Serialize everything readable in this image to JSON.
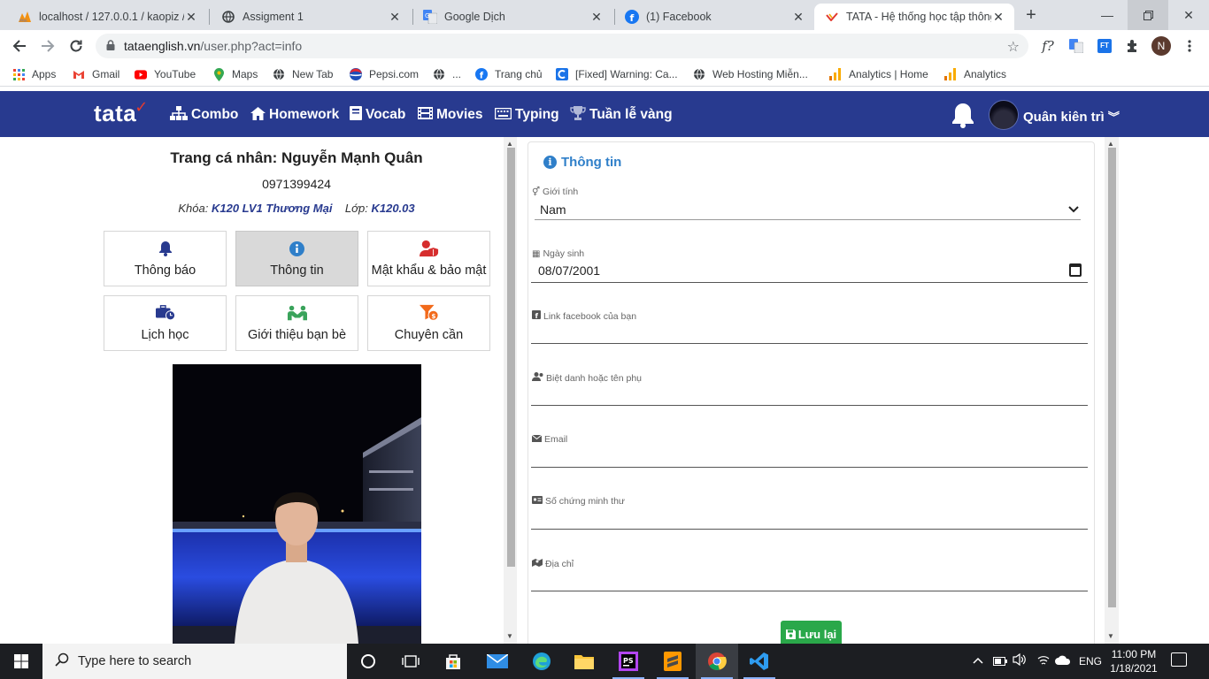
{
  "browser": {
    "tabs": [
      {
        "title": "localhost / 127.0.0.1 / kaopiz /",
        "icon": "phpmyadmin-icon"
      },
      {
        "title": "Assigment 1",
        "icon": "globe-icon"
      },
      {
        "title": "Google Dịch",
        "icon": "google-translate-icon"
      },
      {
        "title": "(1) Facebook",
        "icon": "facebook-icon"
      },
      {
        "title": "TATA - Hệ thống học tập thông",
        "icon": "tata-icon",
        "active": true
      }
    ],
    "url_host": "tataenglish.vn",
    "url_path": "/user.php?act=info",
    "bookmarks": [
      {
        "label": "Apps",
        "icon": "apps-grid-icon"
      },
      {
        "label": "Gmail",
        "icon": "gmail-icon"
      },
      {
        "label": "YouTube",
        "icon": "youtube-icon"
      },
      {
        "label": "Maps",
        "icon": "maps-icon"
      },
      {
        "label": "New Tab",
        "icon": "globe-icon"
      },
      {
        "label": "Pepsi.com",
        "icon": "pepsi-icon"
      },
      {
        "label": "...",
        "icon": "globe-icon"
      },
      {
        "label": "Trang chủ",
        "icon": "facebook-icon"
      },
      {
        "label": "[Fixed] Warning: Ca...",
        "icon": "c-icon"
      },
      {
        "label": "Web Hosting Miễn...",
        "icon": "globe-icon"
      },
      {
        "label": "Analytics | Home",
        "icon": "analytics-icon"
      },
      {
        "label": "Analytics",
        "icon": "analytics-icon"
      }
    ],
    "profile_initial": "N",
    "ext_formula": "f?",
    "ext_ft": "FT"
  },
  "site": {
    "logo": "tata",
    "nav": [
      {
        "label": "Combo",
        "icon": "sitemap-icon"
      },
      {
        "label": "Homework",
        "icon": "home-icon"
      },
      {
        "label": "Vocab",
        "icon": "book-icon"
      },
      {
        "label": "Movies",
        "icon": "film-icon"
      },
      {
        "label": "Typing",
        "icon": "keyboard-icon"
      },
      {
        "label": "Tuần lễ vàng",
        "icon": "trophy-icon"
      }
    ],
    "user_name": "Quân kiên trì"
  },
  "profile": {
    "title": "Trang cá nhân: Nguyễn Mạnh Quân",
    "phone": "0971399424",
    "course_label": "Khóa:",
    "course_value": "K120 LV1 Thương Mại",
    "class_label": "Lớp:",
    "class_value": "K120.03",
    "menu": [
      {
        "label": "Thông báo",
        "icon": "bell-icon",
        "color": "#283a8f"
      },
      {
        "label": "Thông tin",
        "icon": "info-icon",
        "color": "#2f7fc9",
        "active": true
      },
      {
        "label": "Mật khẩu & bảo mật",
        "icon": "user-shield-icon",
        "color": "#d62d2d"
      },
      {
        "label": "Lịch học",
        "icon": "briefcase-clock-icon",
        "color": "#283a8f"
      },
      {
        "label": "Giới thiệu bạn bè",
        "icon": "friends-icon",
        "color": "#3aa35b"
      },
      {
        "label": "Chuyên cần",
        "icon": "funnel-coin-icon",
        "color": "#f26a1b"
      }
    ]
  },
  "form": {
    "title": "Thông tin",
    "gender_label": "Giới tính",
    "gender_value": "Nam",
    "birthday_label": "Ngày sinh",
    "birthday_value": "08/07/2001",
    "facebook_label": "Link facebook của bạn",
    "facebook_value": "",
    "nickname_label": "Biệt danh hoặc tên phụ",
    "nickname_value": "",
    "email_label": "Email",
    "email_value": "",
    "idcard_label": "Số chứng minh thư",
    "idcard_value": "",
    "address_label": "Địa chỉ",
    "address_value": "",
    "save_label": "Lưu lại"
  },
  "taskbar": {
    "search_placeholder": "Type here to search",
    "language": "ENG",
    "time": "11:00 PM",
    "date": "1/18/2021"
  }
}
